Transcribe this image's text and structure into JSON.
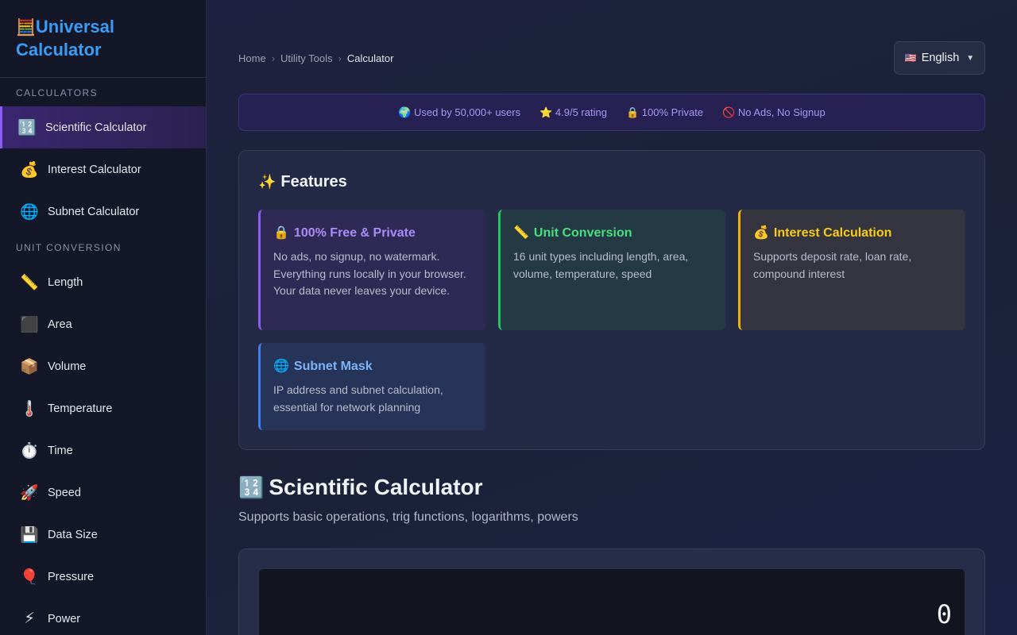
{
  "sidebar": {
    "brand": {
      "icon": "🧮",
      "line1": "Universal",
      "line2": "Calculator"
    },
    "sections": [
      {
        "label": "CALCULATORS",
        "items": [
          {
            "icon": "🔢",
            "label": "Scientific Calculator",
            "active": true
          },
          {
            "icon": "💰",
            "label": "Interest Calculator"
          },
          {
            "icon": "🌐",
            "label": "Subnet Calculator"
          }
        ]
      },
      {
        "label": "UNIT CONVERSION",
        "items": [
          {
            "icon": "📏",
            "label": "Length"
          },
          {
            "icon": "⬛",
            "label": "Area"
          },
          {
            "icon": "📦",
            "label": "Volume"
          },
          {
            "icon": "🌡️",
            "label": "Temperature"
          },
          {
            "icon": "⏱️",
            "label": "Time"
          },
          {
            "icon": "🚀",
            "label": "Speed"
          },
          {
            "icon": "💾",
            "label": "Data Size"
          },
          {
            "icon": "🎈",
            "label": "Pressure"
          },
          {
            "icon": "⚡",
            "label": "Power"
          }
        ]
      }
    ]
  },
  "breadcrumb": {
    "home": "Home",
    "parent": "Utility Tools",
    "current": "Calculator",
    "separator": "›"
  },
  "language": {
    "flag": "🇺🇸",
    "label": "English",
    "caret": "▼"
  },
  "stats": {
    "users": "🌍 Used by 50,000+ users",
    "rating": "⭐ 4.9/5 rating",
    "private": "🔒 100% Private",
    "noads": "🚫 No Ads, No Signup"
  },
  "features": {
    "icon": "✨",
    "title": "Features",
    "cards": {
      "free": {
        "icon": "🔒",
        "title": "100% Free & Private",
        "desc": "No ads, no signup, no watermark. Everything runs locally in your browser. Your data never leaves your device.",
        "color": "#8b5cf6"
      },
      "unit": {
        "icon": "📏",
        "title": "Unit Conversion",
        "desc": "16 unit types including length, area, volume, temperature, speed",
        "color": "#22c55e"
      },
      "interest": {
        "icon": "💰",
        "title": "Interest Calculation",
        "desc": "Supports deposit rate, loan rate, compound interest",
        "color": "#eab308"
      },
      "subnet": {
        "icon": "🌐",
        "title": "Subnet Mask",
        "desc": "IP address and subnet calculation, essential for network planning",
        "color": "#3b82f6"
      }
    }
  },
  "calculator": {
    "icon": "🔢",
    "title": "Scientific Calculator",
    "subtitle": "Supports basic operations, trig functions, logarithms, powers",
    "display": "0"
  },
  "colors": {
    "accent": "#8b5cf6",
    "brand": "#3b9cf5",
    "sidebar_bg": "#141728",
    "main_bg": "#1e2240"
  }
}
